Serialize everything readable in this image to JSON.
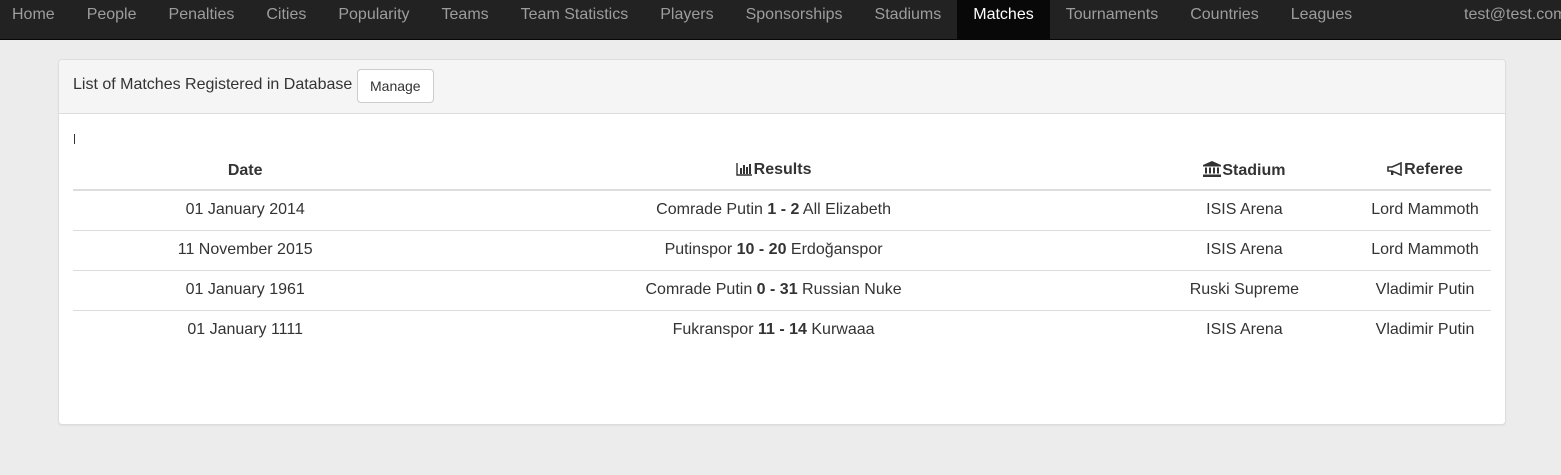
{
  "nav": {
    "items": [
      "Home",
      "People",
      "Penalties",
      "Cities",
      "Popularity",
      "Teams",
      "Team Statistics",
      "Players",
      "Sponsorships",
      "Stadiums",
      "Matches",
      "Tournaments",
      "Countries",
      "Leagues"
    ],
    "active": "Matches",
    "user": "test@test.com"
  },
  "panel": {
    "title": "List of Matches Registered in Database",
    "manage_label": "Manage"
  },
  "table": {
    "headers": {
      "date": "Date",
      "results": "Results",
      "stadium": "Stadium",
      "referee": "Referee"
    },
    "icons": {
      "results": "bar-chart-icon",
      "stadium": "building-icon",
      "referee": "megaphone-icon"
    },
    "rows": [
      {
        "date": "01 January 2014",
        "home": "Comrade Putin",
        "score": "1 - 2",
        "away": "All Elizabeth",
        "stadium": "ISIS Arena",
        "referee": "Lord Mammoth"
      },
      {
        "date": "11 November 2015",
        "home": "Putinspor",
        "score": "10 - 20",
        "away": "Erdoğanspor",
        "stadium": "ISIS Arena",
        "referee": "Lord Mammoth"
      },
      {
        "date": "01 January 1961",
        "home": "Comrade Putin",
        "score": "0 - 31",
        "away": "Russian Nuke",
        "stadium": "Ruski Supreme",
        "referee": "Vladimir Putin"
      },
      {
        "date": "01 January 1111",
        "home": "Fukranspor",
        "score": "11 - 14",
        "away": "Kurwaaa",
        "stadium": "ISIS Arena",
        "referee": "Vladimir Putin"
      }
    ]
  }
}
